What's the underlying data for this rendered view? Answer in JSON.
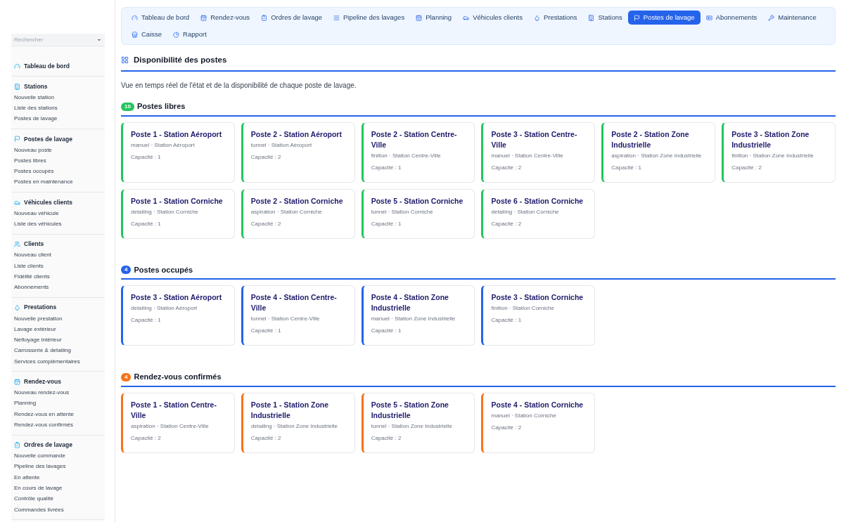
{
  "sidebar": {
    "search": {
      "placeholder": "Rechercher"
    },
    "groups": [
      {
        "title": "Tableau de bord"
      },
      {
        "title": "Stations",
        "items": [
          "Nouvelle station",
          "Liste des stations",
          "Postes de lavage"
        ]
      },
      {
        "title": "Postes de lavage",
        "items": [
          "Nouveau poste",
          "Postes libres",
          "Postes occupés",
          "Postes en maintenance"
        ]
      },
      {
        "title": "Véhicules clients",
        "items": [
          "Nouveau véhicule",
          "Liste des véhicules"
        ]
      },
      {
        "title": "Clients",
        "items": [
          "Nouveau client",
          "Liste clients",
          "Fidélité clients",
          "Abonnements"
        ]
      },
      {
        "title": "Prestations",
        "items": [
          "Nouvelle prestation",
          "Lavage extérieur",
          "Nettoyage intérieur",
          "Carrosserie & detailing",
          "Services complémentaires"
        ]
      },
      {
        "title": "Rendez-vous",
        "items": [
          "Nouveau rendez-vous",
          "Planning",
          "Rendez-vous en attente",
          "Rendez-vous confirmés"
        ]
      },
      {
        "title": "Ordres de lavage",
        "items": [
          "Nouvelle commande",
          "Pipeline des lavages",
          "En attente",
          "En cours de lavage",
          "Contrôle qualité",
          "Commandes livrées"
        ]
      }
    ]
  },
  "nav": [
    {
      "label": "Tableau de bord",
      "selected": false
    },
    {
      "label": "Rendez-vous",
      "selected": false
    },
    {
      "label": "Ordres de lavage",
      "selected": false
    },
    {
      "label": "Pipeline des lavages",
      "selected": false
    },
    {
      "label": "Planning",
      "selected": false
    },
    {
      "label": "Véhicules clients",
      "selected": false
    },
    {
      "label": "Prestations",
      "selected": false
    },
    {
      "label": "Stations",
      "selected": false
    },
    {
      "label": "Postes de lavage",
      "selected": true
    },
    {
      "label": "Abonnements",
      "selected": false
    },
    {
      "label": "Maintenance",
      "selected": false
    },
    {
      "label": "Caisse",
      "selected": false
    },
    {
      "label": "Rapport",
      "selected": false
    }
  ],
  "page": {
    "title": "Disponibilité des postes",
    "description": "Vue en temps réel de l'état et de la disponibilité de chaque poste de lavage."
  },
  "sections": [
    {
      "title": "Postes libres",
      "count": "10",
      "color": "#22c55e",
      "cards": [
        {
          "title": "Poste 1 - Station Aéroport",
          "meta": "manuel · Station Aéroport",
          "capacity": "Capacité : 1"
        },
        {
          "title": "Poste 2 - Station Aéroport",
          "meta": "tunnel · Station Aéroport",
          "capacity": "Capacité : 2"
        },
        {
          "title": "Poste 2 - Station Centre-Ville",
          "meta": "finition · Station Centre-Ville",
          "capacity": "Capacité : 1"
        },
        {
          "title": "Poste 3 - Station Centre-Ville",
          "meta": "manuel · Station Centre-Ville",
          "capacity": "Capacité : 2"
        },
        {
          "title": "Poste 2 - Station Zone Industrielle",
          "meta": "aspiration · Station Zone Industrielle",
          "capacity": "Capacité : 1"
        },
        {
          "title": "Poste 3 - Station Zone Industrielle",
          "meta": "finition · Station Zone Industrielle",
          "capacity": "Capacité : 2"
        },
        {
          "title": "Poste 1 - Station Corniche",
          "meta": "detailing · Station Corniche",
          "capacity": "Capacité : 1"
        },
        {
          "title": "Poste 2 - Station Corniche",
          "meta": "aspiration · Station Corniche",
          "capacity": "Capacité : 2"
        },
        {
          "title": "Poste 5 - Station Corniche",
          "meta": "tunnel · Station Corniche",
          "capacity": "Capacité : 1"
        },
        {
          "title": "Poste 6 - Station Corniche",
          "meta": "detailing · Station Corniche",
          "capacity": "Capacité : 2"
        }
      ]
    },
    {
      "title": "Postes occupés",
      "count": "4",
      "color": "#2563eb",
      "cards": [
        {
          "title": "Poste 3 - Station Aéroport",
          "meta": "detailing · Station Aéroport",
          "capacity": "Capacité : 1"
        },
        {
          "title": "Poste 4 - Station Centre-Ville",
          "meta": "tunnel · Station Centre-Ville",
          "capacity": "Capacité : 1"
        },
        {
          "title": "Poste 4 - Station Zone Industrielle",
          "meta": "manuel · Station Zone Industrielle",
          "capacity": "Capacité : 1"
        },
        {
          "title": "Poste 3 - Station Corniche",
          "meta": "finition · Station Corniche",
          "capacity": "Capacité : 1"
        }
      ]
    },
    {
      "title": "Rendez-vous confirmés",
      "count": "4",
      "color": "#f97316",
      "cards": [
        {
          "title": "Poste 1 - Station Centre-Ville",
          "meta": "aspiration · Station Centre-Ville",
          "capacity": "Capacité : 2"
        },
        {
          "title": "Poste 1 - Station Zone Industrielle",
          "meta": "detailing · Station Zone Industrielle",
          "capacity": "Capacité : 2"
        },
        {
          "title": "Poste 5 - Station Zone Industrielle",
          "meta": "tunnel · Station Zone Industrielle",
          "capacity": "Capacité : 2"
        },
        {
          "title": "Poste 4 - Station Corniche",
          "meta": "manuel · Station Corniche",
          "capacity": "Capacité : 2"
        }
      ]
    }
  ]
}
